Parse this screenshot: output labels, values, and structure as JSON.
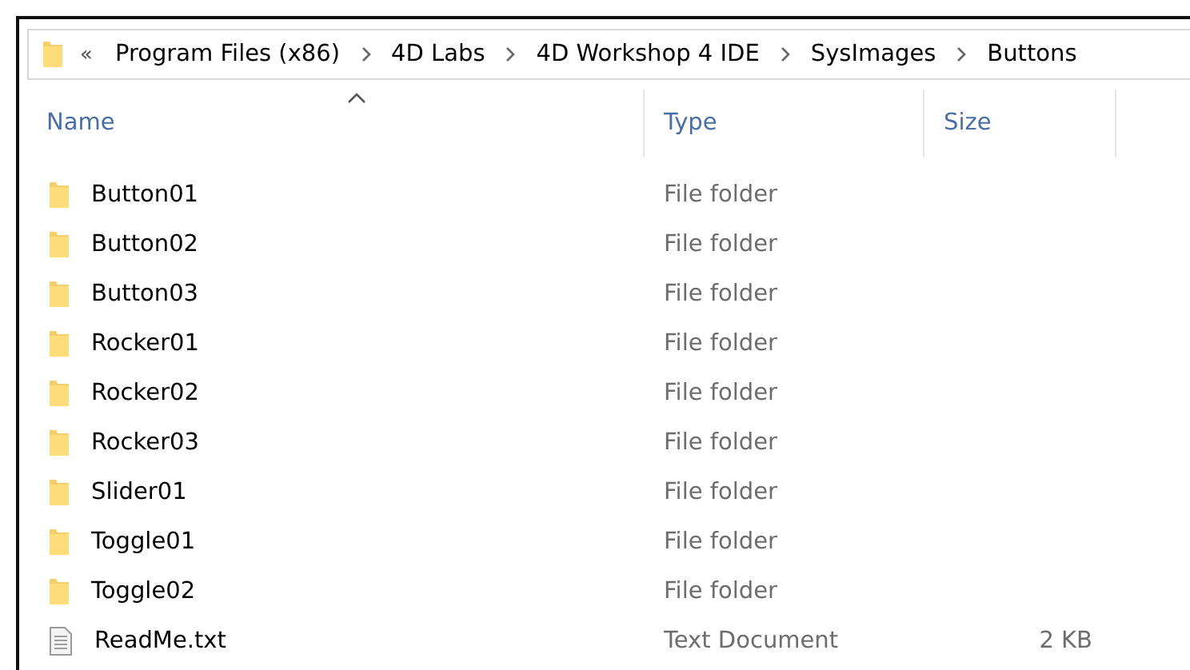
{
  "address_bar": {
    "overflow": "«",
    "path": [
      "Program Files (x86)",
      "4D Labs",
      "4D Workshop 4 IDE",
      "SysImages",
      "Buttons"
    ]
  },
  "columns": [
    {
      "label": "Name",
      "sorted": true
    },
    {
      "label": "Type",
      "sorted": false
    },
    {
      "label": "Size",
      "sorted": false
    }
  ],
  "rows": [
    {
      "kind": "folder",
      "name": "Button01",
      "type": "File folder"
    },
    {
      "kind": "folder",
      "name": "Button02",
      "type": "File folder"
    },
    {
      "kind": "folder",
      "name": "Button03",
      "type": "File folder"
    },
    {
      "kind": "folder",
      "name": "Rocker01",
      "type": "File folder"
    },
    {
      "kind": "folder",
      "name": "Rocker02",
      "type": "File folder"
    },
    {
      "kind": "folder",
      "name": "Rocker03",
      "type": "File folder"
    },
    {
      "kind": "folder",
      "name": "Slider01",
      "type": "File folder"
    },
    {
      "kind": "folder",
      "name": "Toggle01",
      "type": "File folder"
    },
    {
      "kind": "folder",
      "name": "Toggle02",
      "type": "File folder"
    },
    {
      "kind": "file",
      "name": "ReadMe.txt",
      "type": "Text Document",
      "size": "2 KB"
    }
  ]
}
